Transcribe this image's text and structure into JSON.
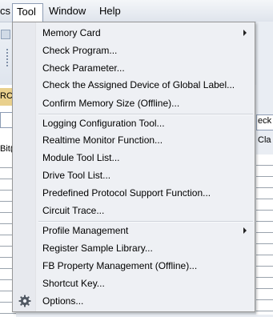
{
  "menubar": {
    "items": [
      {
        "label": "cs"
      },
      {
        "label": "Tool"
      },
      {
        "label": "Window"
      },
      {
        "label": "Help"
      }
    ]
  },
  "left_panel": {
    "band_text": "RC",
    "column_text": "Bit("
  },
  "right_panel": {
    "top_text": "eck",
    "column_text": "Cla"
  },
  "tool_menu": {
    "items": [
      {
        "label": "Memory Card",
        "submenu": true
      },
      {
        "label": "Check Program...",
        "submenu": false
      },
      {
        "label": "Check Parameter...",
        "submenu": false
      },
      {
        "label": "Check the Assigned Device of Global Label...",
        "submenu": false
      },
      {
        "label": "Confirm Memory Size (Offline)...",
        "submenu": false
      },
      {
        "label": "Logging Configuration Tool...",
        "submenu": false
      },
      {
        "label": "Realtime Monitor Function...",
        "submenu": false
      },
      {
        "label": "Module Tool List...",
        "submenu": false
      },
      {
        "label": "Drive Tool List...",
        "submenu": false
      },
      {
        "label": "Predefined Protocol Support Function...",
        "submenu": false
      },
      {
        "label": "Circuit Trace...",
        "submenu": false
      },
      {
        "label": "Profile Management",
        "submenu": true
      },
      {
        "label": "Register Sample Library...",
        "submenu": false
      },
      {
        "label": "FB Property Management (Offline)...",
        "submenu": false
      },
      {
        "label": "Shortcut Key...",
        "submenu": false
      },
      {
        "label": "Options...",
        "submenu": false,
        "icon": "gear-icon"
      }
    ]
  }
}
